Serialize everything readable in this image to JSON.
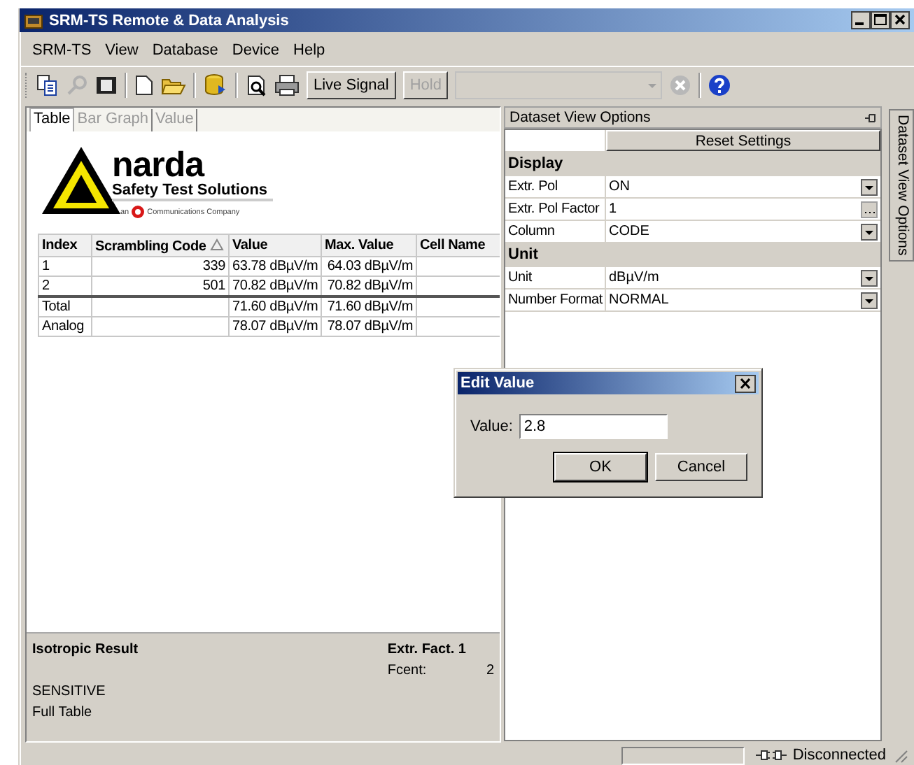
{
  "window": {
    "title": "SRM-TS Remote & Data Analysis"
  },
  "menu": [
    {
      "label": "SRM-TS"
    },
    {
      "label": "View"
    },
    {
      "label": "Database"
    },
    {
      "label": "Device"
    },
    {
      "label": "Help"
    }
  ],
  "toolbar": {
    "buttons": [
      {
        "label": "Live Signal",
        "disabled": false
      },
      {
        "label": "Hold",
        "disabled": true
      }
    ]
  },
  "left_panel": {
    "tabs": [
      {
        "label": "Table",
        "selected": true
      },
      {
        "label": "Bar Graph",
        "selected": false
      },
      {
        "label": "Value",
        "selected": false
      }
    ],
    "logo": {
      "name": "narda",
      "tagline": "Safety Test Solutions",
      "prefix": "an",
      "suffix": "Communications Company"
    },
    "table": {
      "columns": [
        {
          "label": "Index",
          "sorted": false
        },
        {
          "label": "Scrambling Code",
          "sorted": true
        },
        {
          "label": "Value",
          "sorted": false
        },
        {
          "label": "Max. Value",
          "sorted": false
        },
        {
          "label": "Cell Name",
          "sorted": false
        }
      ],
      "rows": [
        {
          "kind": "data",
          "index": "1",
          "scrambling_code": "339",
          "value": "63.78 dBµV/m",
          "max_value": "64.03 dBµV/m"
        },
        {
          "kind": "data",
          "index": "2",
          "scrambling_code": "501",
          "value": "70.82 dBµV/m",
          "max_value": "70.82 dBµV/m"
        },
        {
          "kind": "summary",
          "index": "Total",
          "value": "71.60 dBµV/m",
          "max_value": "71.60 dBµV/m"
        },
        {
          "kind": "summary",
          "index": "Analog",
          "value": "78.07 dBµV/m",
          "max_value": "78.07 dBµV/m"
        }
      ]
    },
    "footer": {
      "result_label": "Isotropic Result",
      "extr_fact": "Extr. Fact. 1",
      "fcent_label": "Fcent:",
      "fcent_value": "2",
      "mode": "SENSITIVE",
      "view": "Full Table"
    }
  },
  "right_panel": {
    "title": "Dataset View Options",
    "reset_button": "Reset Settings",
    "sections": [
      {
        "title": "Display",
        "properties": [
          {
            "name": "Extr. Pol",
            "value": "ON",
            "kind": "dropdown"
          },
          {
            "name": "Extr. Pol Factor",
            "value": "1",
            "kind": "ellipsis"
          },
          {
            "name": "Column",
            "value": "CODE",
            "kind": "dropdown"
          }
        ]
      },
      {
        "title": "Unit",
        "properties": [
          {
            "name": "Unit",
            "value": "dBµV/m",
            "kind": "dropdown"
          },
          {
            "name": "Number Format",
            "value": "NORMAL",
            "kind": "dropdown"
          }
        ]
      }
    ]
  },
  "side_tab": {
    "label": "Dataset View Options"
  },
  "dialog": {
    "title": "Edit Value",
    "label": "Value:",
    "value": "2.8",
    "buttons": [
      "OK",
      "Cancel"
    ]
  },
  "status_bar": {
    "text": "Disconnected"
  }
}
